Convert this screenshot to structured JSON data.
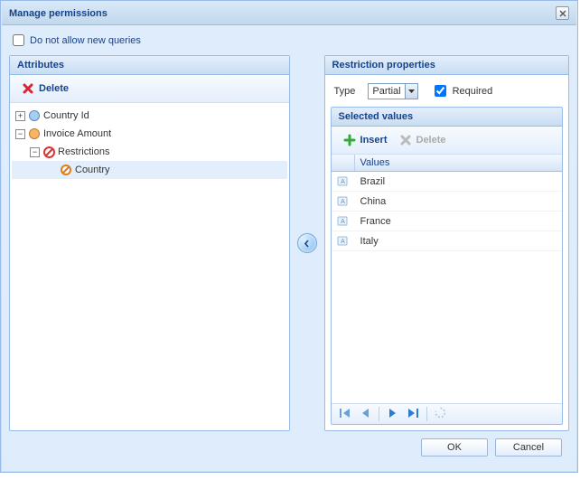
{
  "dialog": {
    "title": "Manage permissions"
  },
  "checkbox": {
    "label": "Do not allow new queries",
    "checked": false
  },
  "attributes": {
    "panel_title": "Attributes",
    "delete_label": "Delete",
    "tree": {
      "node0": {
        "label": "Country Id"
      },
      "node1": {
        "label": "Invoice Amount"
      },
      "node1_0": {
        "label": "Restrictions"
      },
      "node1_0_0": {
        "label": "Country"
      }
    }
  },
  "restriction": {
    "panel_title": "Restriction properties",
    "type_label": "Type",
    "type_value": "Partial",
    "required_label": "Required",
    "required_checked": true,
    "selected_values_title": "Selected values",
    "insert_label": "Insert",
    "delete_label": "Delete",
    "column_header": "Values",
    "rows": {
      "r0": "Brazil",
      "r1": "China",
      "r2": "France",
      "r3": "Italy"
    }
  },
  "footer": {
    "ok": "OK",
    "cancel": "Cancel"
  }
}
